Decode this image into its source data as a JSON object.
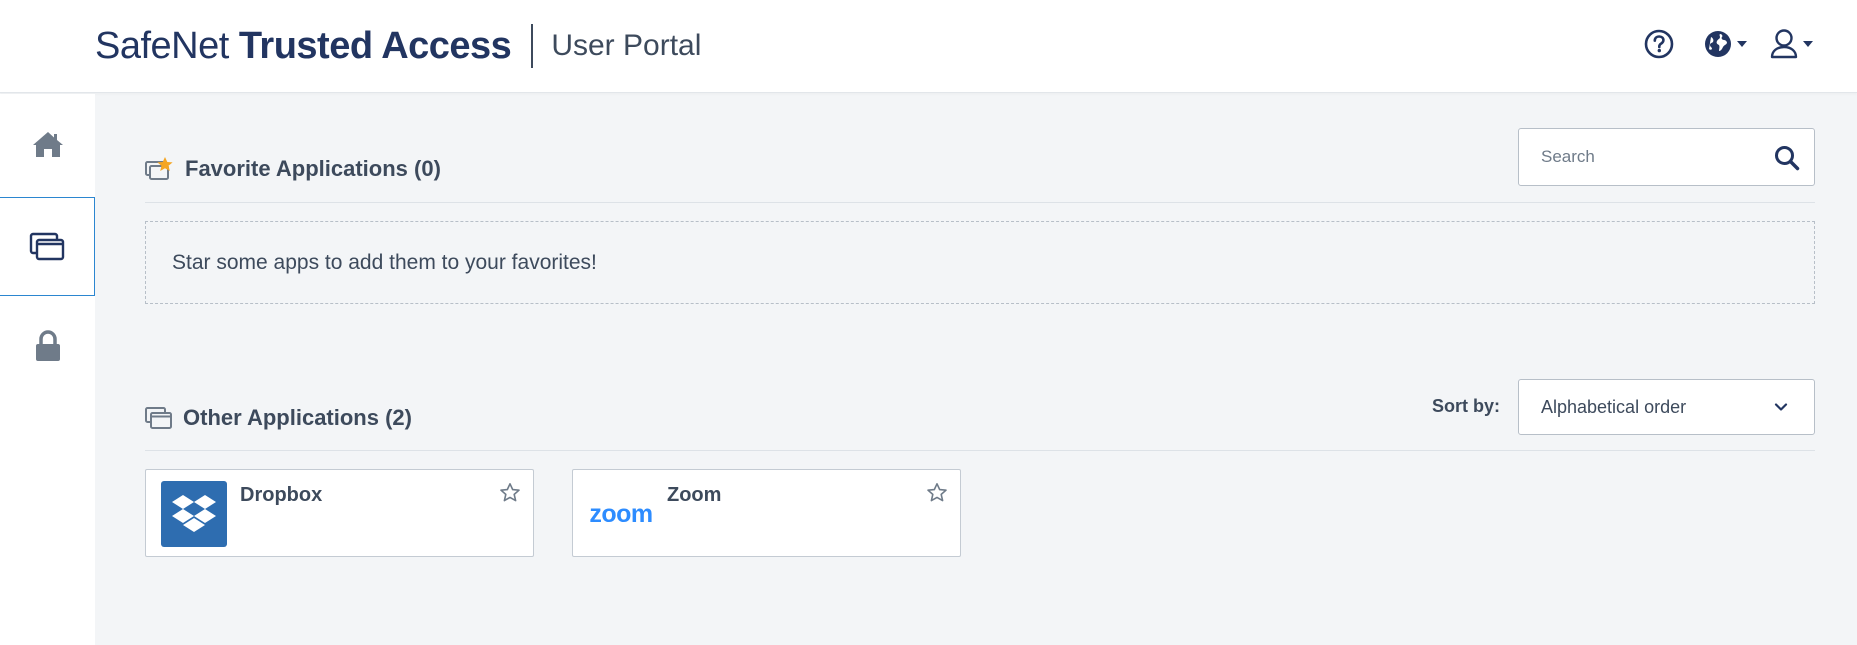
{
  "header": {
    "brand_name": "SafeNet",
    "brand_product": "Trusted Access",
    "portal_title": "User Portal",
    "icons": [
      "help-icon",
      "globe-icon",
      "user-icon"
    ]
  },
  "sidebar": {
    "items": [
      {
        "name": "home",
        "icon": "home-icon",
        "active": false
      },
      {
        "name": "applications",
        "icon": "windows-icon",
        "active": true
      },
      {
        "name": "security",
        "icon": "lock-icon",
        "active": false
      }
    ]
  },
  "favorites": {
    "title": "Favorite Applications (0)",
    "empty_message": "Star some apps to add them to your favorites!"
  },
  "search": {
    "placeholder": "Search"
  },
  "other": {
    "title": "Other Applications (2)",
    "sort_label": "Sort by:",
    "sort_value": "Alphabetical order",
    "apps": [
      {
        "name": "Dropbox",
        "logo": "dropbox-logo"
      },
      {
        "name": "Zoom",
        "logo_text": "zoom"
      }
    ]
  },
  "colors": {
    "brand_navy": "#223561",
    "text": "#3d4a5c",
    "background": "#f3f5f7",
    "accent_blue": "#2b86d0",
    "favorite_star": "#f5a623",
    "dropbox_blue": "#2e6db0",
    "zoom_blue": "#2d8cff"
  }
}
